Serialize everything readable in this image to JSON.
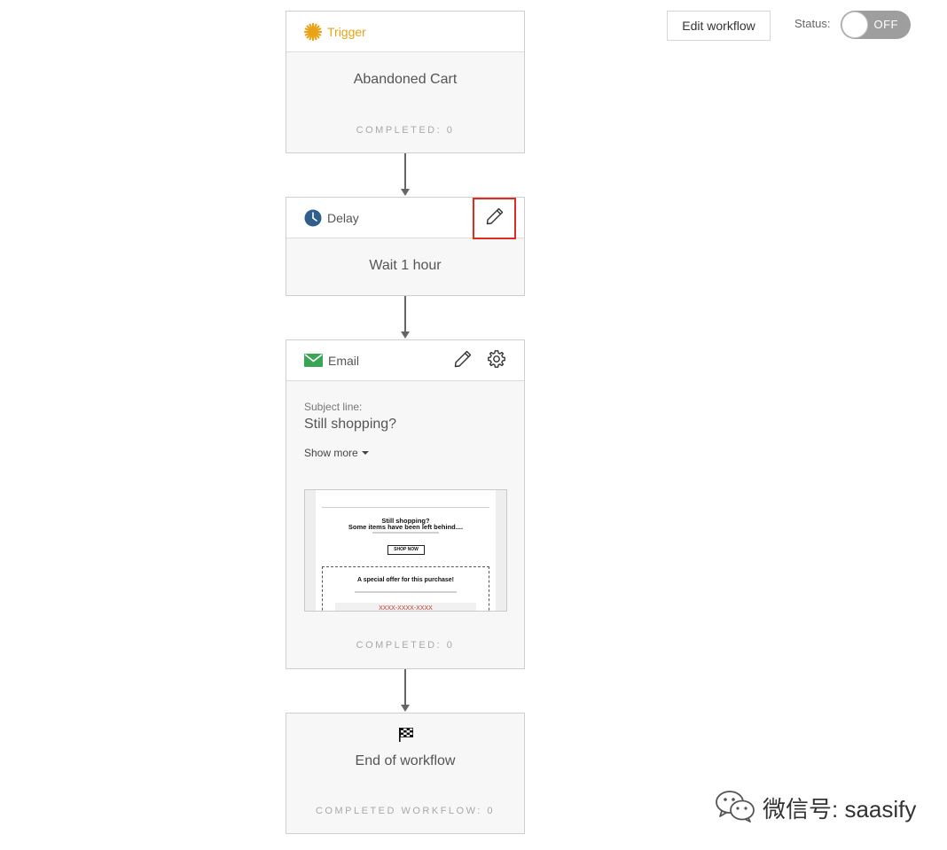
{
  "toolbar": {
    "edit_label": "Edit workflow",
    "status_label": "Status:",
    "toggle_state": "OFF"
  },
  "trigger": {
    "title": "Trigger",
    "event": "Abandoned Cart",
    "completed": "COMPLETED: 0",
    "icon": "starburst-icon",
    "color": "#e8a317"
  },
  "delay": {
    "title": "Delay",
    "text": "Wait 1 hour",
    "icon": "clock-icon",
    "edit_icon": "pencil-icon",
    "color": "#2f5f8a",
    "highlight_color": "#e02b20"
  },
  "email": {
    "title": "Email",
    "subject_label": "Subject line:",
    "subject": "Still shopping?",
    "show_more": "Show more",
    "completed": "COMPLETED: 0",
    "icon": "envelope-icon",
    "color": "#3aa655",
    "preview": {
      "headline": "Still shopping?",
      "subheadline": "Some items have been left behind....",
      "cta": "SHOP NOW",
      "offer_title": "A special offer for this purchase!",
      "code": "XXXX-XXXX-XXXX"
    }
  },
  "end": {
    "title": "End of workflow",
    "completed": "COMPLETED WORKFLOW: 0",
    "icon": "checkered-flag-icon"
  },
  "watermark": {
    "text": "微信号: saasify",
    "icon": "wechat-icon"
  }
}
